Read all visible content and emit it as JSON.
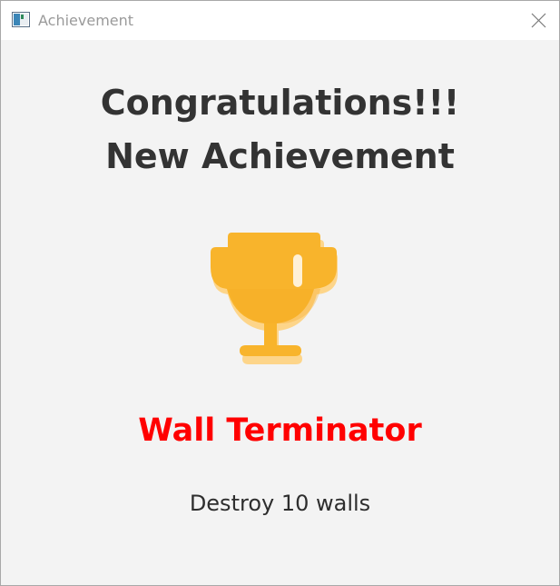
{
  "window": {
    "title": "Achievement"
  },
  "heading": {
    "line1": "Congratulations!!!",
    "line2": "New Achievement"
  },
  "achievement": {
    "name": "Wall Terminator",
    "description": "Destroy 10 walls",
    "icon": "trophy-icon"
  },
  "colors": {
    "trophy": "#f8b42c",
    "trophy_shadow": "#fdd58a",
    "name": "#ff0000",
    "heading": "#333333",
    "background": "#f3f3f3"
  }
}
